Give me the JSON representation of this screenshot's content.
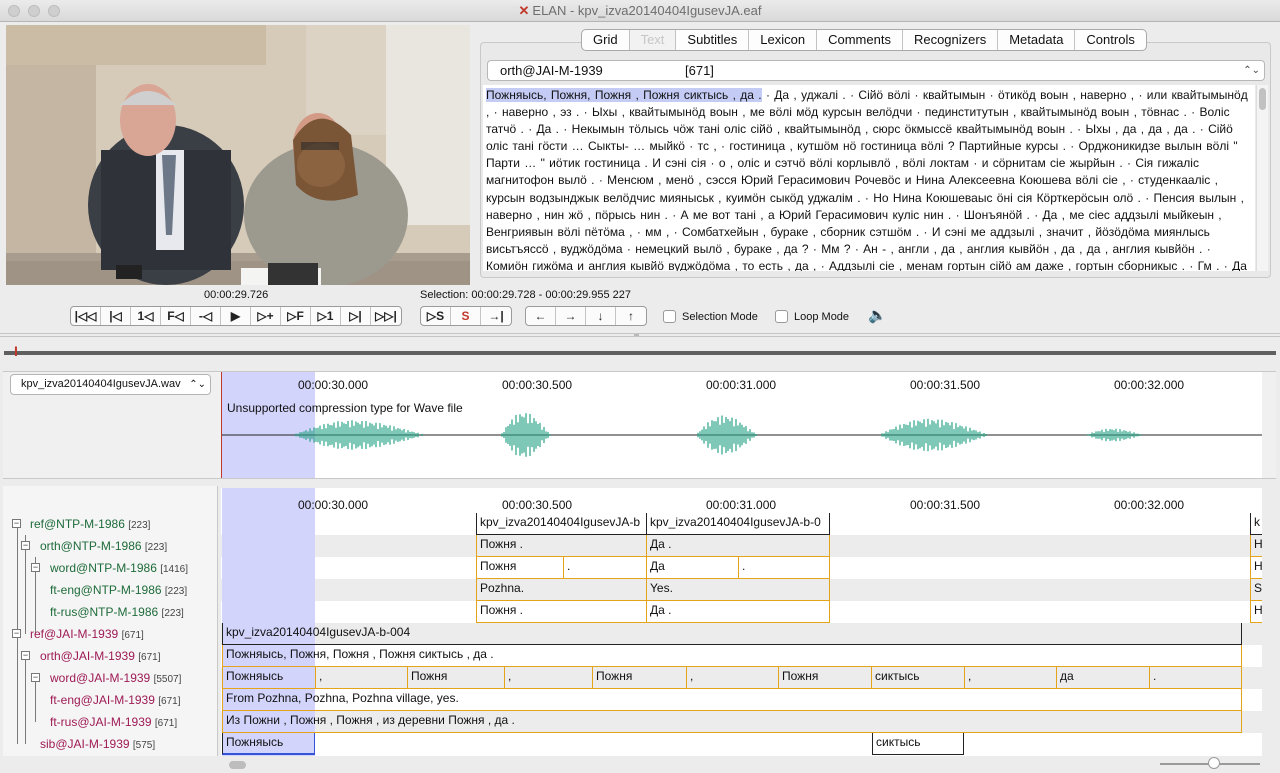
{
  "window": {
    "title": "ELAN - kpv_izva20140404IgusevJA.eaf"
  },
  "tabs": [
    {
      "label": "Grid"
    },
    {
      "label": "Text"
    },
    {
      "label": "Subtitles"
    },
    {
      "label": "Lexicon"
    },
    {
      "label": "Comments"
    },
    {
      "label": "Recognizers"
    },
    {
      "label": "Metadata"
    },
    {
      "label": "Controls"
    }
  ],
  "active_tab": "Text",
  "text_viewer": {
    "tier": "orth@JAI-M-1939",
    "count": "[671]",
    "highlight": "Пожняысь, Пожня, Пожня , Пожня сиктысь , да .",
    "body": " · Да , уджалі .  · Сійӧ вӧлі  · квайтымын  · ӧтикӧд воын , наверно ,  · или квайтымынӧд ,  · наверно , эз .  · Ыхы , квайтымынӧд воын , ме вӧлі мӧд курсын велӧдчи  · пединститутын , квайтымынӧд воын , тӧвнас .  · Волiс татчӧ .  · Да .  · Некымын тӧлысь чӧж танi олiс сійӧ , квайтымынӧд , сюрс ӧкмыссё квайтымынӧд воын .  · Ыхы , да , да , да .  · Сійӧ олiс танi гӧсти … Сыкты- … мыйкӧ  · тс ,  · гостиница , кутшӧм нӧ гостиница вӧлi ? Партийные курсы .  · Орджоникидзе вылын вӧлi \" Парти … \" иӧтик гостиница . И сэні сія  · о , олiс и сэтчӧ вӧлi корлывлӧ , вӧлi локтам  · и сӧрнитам сіе жырйын .  · Сія гижаліс магнитофон вылӧ .  · Менсюм , менӧ , сэсся Юрий Герасимович Рочевӧс и Нина Алексеевна Коюшева вӧлi сіе ,  · студенкаалiс , курсын водзынджык велӧдчис мияныськ , куимӧн сыкӧд уджалім .  · Но Нина Коюшеваыс ӧні сія Кӧрткерӧсын олӧ .  · Пенсия вылын , наверно , нин жӧ , пӧрысь нин .  · А ме вот танi , а Юрий Герасимович кулiс нин .  · Шонъянӧй .  · Да , ме сіес аддзылі мыйкеын , Венгриявын вӧлі пётӧма ,  · мм ,  · Сомбатхейын , бураке , сборник сэтшӧм .  · И сэні ме аддзылі , значит , йӧзӧдӧма миянлысь висьтъяссӧ , вуджӧдӧма  · немецкий вылӧ , бураке , да ?  · Мм ?  · Ан - , англи , да , англия кывйӧн , да , да , англия кывйӧн .  · Комиӧн гижӧма и англия кывйӧ вуджӧдӧма , то есть , да ,  · Аддзылі сіе , менам гортын сійӧ ам даже , гортын сборникыс .  · Гм .  · Да , сіе вӧлі любӧй тема позьӧ , сійӧ"
  },
  "player": {
    "media_time": "00:00:29.726",
    "selection": "Selection: 00:00:29.728 - 00:00:29.955  227",
    "buttons": [
      "|◁◁",
      "|◁",
      "1◁",
      "F◁",
      "-◁",
      "▶",
      "▷+",
      "▷F",
      "▷1",
      "▷|",
      "▷▷|"
    ],
    "sel_buttons": [
      "▷S",
      "S",
      "→|"
    ],
    "nav_buttons": [
      "←",
      "→",
      "↓",
      "↑"
    ],
    "selection_mode": "Selection Mode",
    "loop_mode": "Loop Mode"
  },
  "waveform": {
    "file": "kpv_izva20140404IgusevJA.wav",
    "message": "Unsupported compression type for Wave file",
    "color": "#2aa389"
  },
  "ruler_ticks": [
    "00:00:30.000",
    "00:00:30.500",
    "00:00:31.000",
    "00:00:31.500",
    "00:00:32.000"
  ],
  "tiers": [
    {
      "name": "ref@NTP-M-1986",
      "count": "[223]",
      "color": "#1e6b3a"
    },
    {
      "name": "orth@NTP-M-1986",
      "count": "[223]",
      "color": "#1e6b3a"
    },
    {
      "name": "word@NTP-M-1986",
      "count": "[1416]",
      "color": "#1e6b3a"
    },
    {
      "name": "ft-eng@NTP-M-1986",
      "count": "[223]",
      "color": "#1e6b3a"
    },
    {
      "name": "ft-rus@NTP-M-1986",
      "count": "[223]",
      "color": "#1e6b3a"
    },
    {
      "name": "ref@JAI-M-1939",
      "count": "[671]",
      "color": "#9e1b55"
    },
    {
      "name": "orth@JAI-M-1939",
      "count": "[671]",
      "color": "#9e1b55"
    },
    {
      "name": "word@JAI-M-1939",
      "count": "[5507]",
      "color": "#9e1b55"
    },
    {
      "name": "ft-eng@JAI-M-1939",
      "count": "[671]",
      "color": "#9e1b55"
    },
    {
      "name": "ft-rus@JAI-M-1939",
      "count": "[671]",
      "color": "#9e1b55"
    },
    {
      "name": "sib@JAI-M-1939",
      "count": "[575]",
      "color": "#9e1b55"
    }
  ],
  "annotations": {
    "ntp_ref_a": "kpv_izva20140404IgusevJA-b",
    "ntp_ref_b": "kpv_izva20140404IgusevJA-b-0",
    "ntp_ref_c": "k",
    "ntp_orth_a": "Пожня .",
    "ntp_orth_b": "Да .",
    "ntp_orth_c": "Н",
    "ntp_word_a": "Пожня",
    "ntp_word_a2": ".",
    "ntp_word_b": "Да",
    "ntp_word_b2": ".",
    "ntp_word_c": "Н",
    "ntp_eng_a": "Pozhna.",
    "ntp_eng_b": "Yes.",
    "ntp_eng_c": "S",
    "ntp_rus_a": "Пожня .",
    "ntp_rus_b": "Да .",
    "ntp_rus_c": "Н",
    "jai_ref": "kpv_izva20140404IgusevJA-b-004",
    "jai_orth": "Пожняысь, Пожня, Пожня , Пожня сиктысь , да .",
    "jai_words": [
      "Пожняысь",
      ",",
      "Пожня",
      ",",
      "Пожня",
      ",",
      "Пожня",
      "сиктысь",
      ",",
      "да",
      "."
    ],
    "jai_eng": "From Pozhna, Pozhna, Pozhna village, yes.",
    "jai_rus": "Из Пожни , Пожня , Пожня , из деревни Пожня , да .",
    "jai_sib_a": "Пожняысь",
    "jai_sib_b": "сиктысь"
  }
}
